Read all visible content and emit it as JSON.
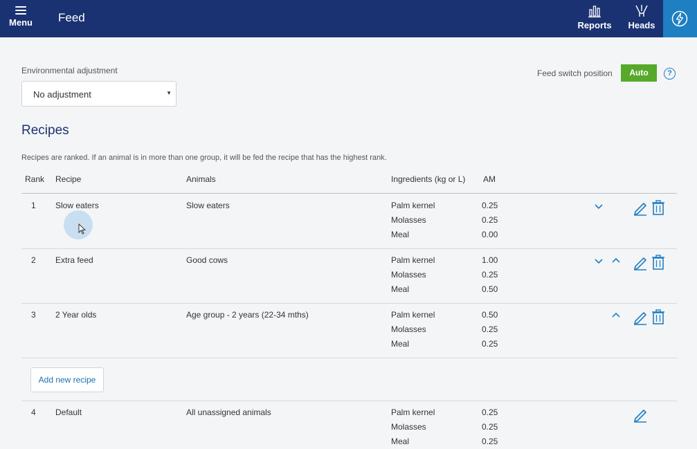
{
  "header": {
    "menu_label": "Menu",
    "title": "Feed",
    "reports_label": "Reports",
    "heads_label": "Heads"
  },
  "env": {
    "label": "Environmental adjustment",
    "value": "No adjustment"
  },
  "feed_switch": {
    "label": "Feed switch position",
    "value": "Auto",
    "help": "?"
  },
  "recipes": {
    "title": "Recipes",
    "note": "Recipes are ranked. If an animal is in more than one group, it will be fed the recipe that has the highest rank.",
    "columns": {
      "rank": "Rank",
      "recipe": "Recipe",
      "animals": "Animals",
      "ingredients": "Ingredients (kg or L)",
      "am": "AM"
    },
    "rows": [
      {
        "rank": "1",
        "recipe": "Slow eaters",
        "animals": "Slow eaters",
        "ingredients": [
          {
            "name": "Palm kernel",
            "am": "0.25"
          },
          {
            "name": "Molasses",
            "am": "0.25"
          },
          {
            "name": "Meal",
            "am": "0.00"
          }
        ]
      },
      {
        "rank": "2",
        "recipe": "Extra feed",
        "animals": "Good cows",
        "ingredients": [
          {
            "name": "Palm kernel",
            "am": "1.00"
          },
          {
            "name": "Molasses",
            "am": "0.25"
          },
          {
            "name": "Meal",
            "am": "0.50"
          }
        ]
      },
      {
        "rank": "3",
        "recipe": "2 Year olds",
        "animals": "Age group - 2 years (22-34 mths)",
        "ingredients": [
          {
            "name": "Palm kernel",
            "am": "0.50"
          },
          {
            "name": "Molasses",
            "am": "0.25"
          },
          {
            "name": "Meal",
            "am": "0.25"
          }
        ]
      }
    ],
    "add_label": "Add new recipe",
    "default_row": {
      "rank": "4",
      "recipe": "Default",
      "animals": "All unassigned animals",
      "ingredients": [
        {
          "name": "Palm kernel",
          "am": "0.25"
        },
        {
          "name": "Molasses",
          "am": "0.25"
        },
        {
          "name": "Meal",
          "am": "0.25"
        }
      ]
    }
  },
  "colors": {
    "header_bg": "#1b3272",
    "accent": "#1e7fc2",
    "auto_green": "#57a92a"
  }
}
